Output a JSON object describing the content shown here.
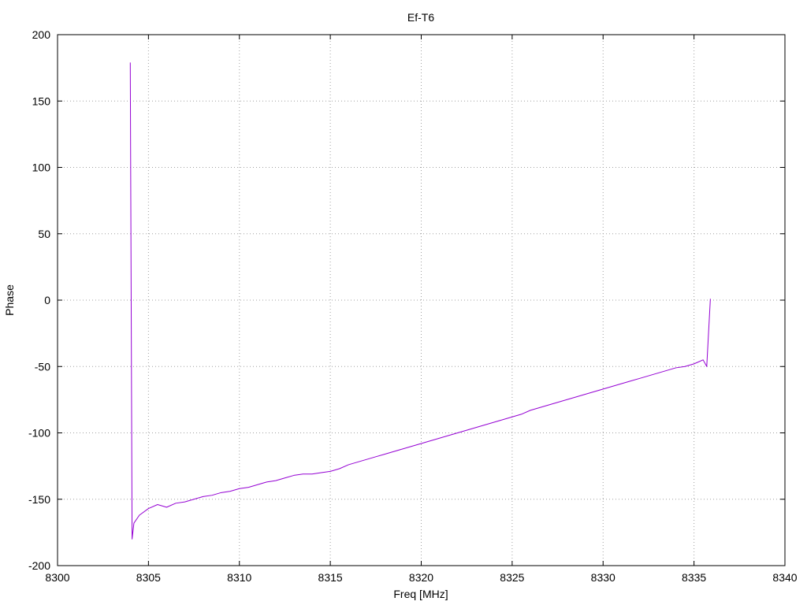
{
  "chart_data": {
    "type": "line",
    "title": "Ef-T6",
    "xlabel": "Freq [MHz]",
    "ylabel": "Phase",
    "xlim": [
      8300,
      8340
    ],
    "ylim": [
      -200,
      200
    ],
    "xticks": [
      8300,
      8305,
      8310,
      8315,
      8320,
      8325,
      8330,
      8335,
      8340
    ],
    "yticks": [
      -200,
      -150,
      -100,
      -50,
      0,
      50,
      100,
      150,
      200
    ],
    "grid": true,
    "series": [
      {
        "color": "#9400d3",
        "x": [
          8304.0,
          8304.1,
          8304.2,
          8304.5,
          8305.0,
          8305.5,
          8306.0,
          8306.5,
          8307.0,
          8307.5,
          8308.0,
          8308.5,
          8309.0,
          8309.5,
          8310.0,
          8310.5,
          8311.0,
          8311.5,
          8312.0,
          8312.5,
          8313.0,
          8313.5,
          8314.0,
          8314.5,
          8315.0,
          8315.5,
          8316.0,
          8316.5,
          8317.0,
          8317.5,
          8318.0,
          8318.5,
          8319.0,
          8319.5,
          8320.0,
          8320.5,
          8321.0,
          8321.5,
          8322.0,
          8322.5,
          8323.0,
          8323.5,
          8324.0,
          8324.5,
          8325.0,
          8325.5,
          8326.0,
          8326.5,
          8327.0,
          8327.5,
          8328.0,
          8328.5,
          8329.0,
          8329.5,
          8330.0,
          8330.5,
          8331.0,
          8331.5,
          8332.0,
          8332.5,
          8333.0,
          8333.5,
          8334.0,
          8334.5,
          8335.0,
          8335.5,
          8335.7,
          8335.9
        ],
        "y": [
          179,
          -180,
          -168,
          -162,
          -157,
          -154,
          -156,
          -153,
          -152,
          -150,
          -148,
          -147,
          -145,
          -144,
          -142,
          -141,
          -139,
          -137,
          -136,
          -134,
          -132,
          -131,
          -131,
          -130,
          -129,
          -127,
          -124,
          -122,
          -120,
          -118,
          -116,
          -114,
          -112,
          -110,
          -108,
          -106,
          -104,
          -102,
          -100,
          -98,
          -96,
          -94,
          -92,
          -90,
          -88,
          -86,
          -83,
          -81,
          -79,
          -77,
          -75,
          -73,
          -71,
          -69,
          -67,
          -65,
          -63,
          -61,
          -59,
          -57,
          -55,
          -53,
          -51,
          -50,
          -48,
          -45,
          -50,
          1
        ]
      }
    ]
  }
}
